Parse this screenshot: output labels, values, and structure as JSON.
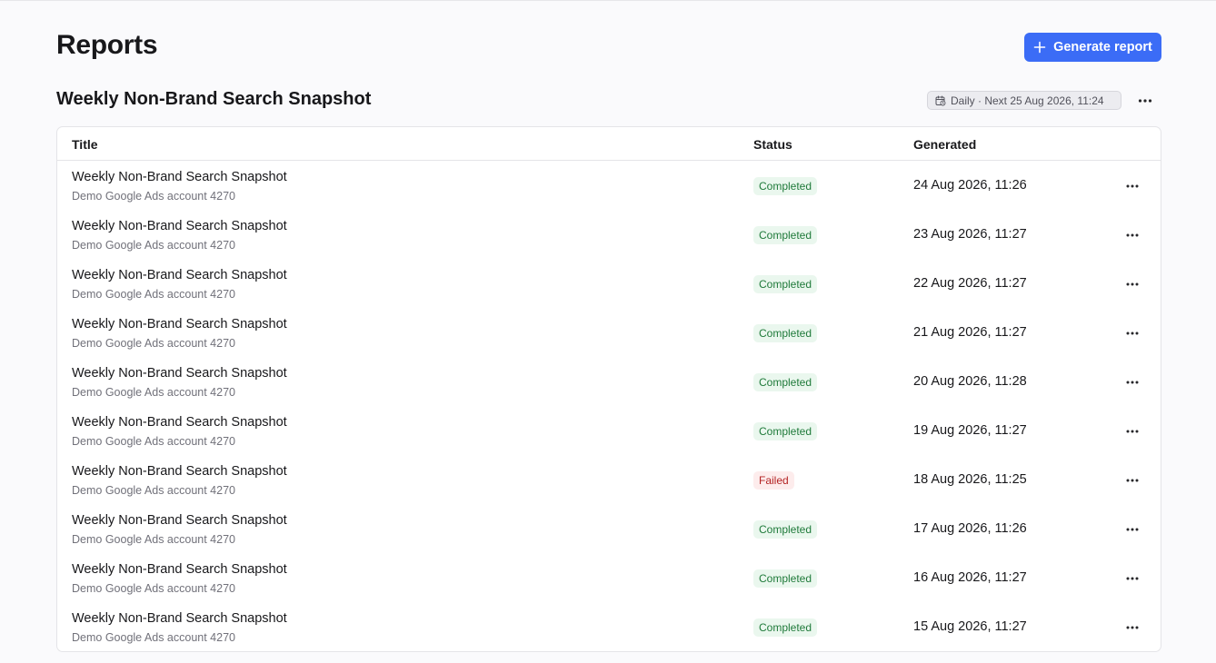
{
  "page": {
    "title": "Reports",
    "generate_button": "Generate report"
  },
  "section": {
    "title": "Weekly Non-Brand Search Snapshot",
    "schedule": "Daily · Next 25 Aug 2026, 11:24"
  },
  "table": {
    "columns": [
      "Title",
      "Status",
      "Generated"
    ],
    "rows": [
      {
        "title": "Weekly Non-Brand Search Snapshot",
        "account": "Demo Google Ads account 4270",
        "status": "Completed",
        "generated": "24 Aug 2026, 11:26"
      },
      {
        "title": "Weekly Non-Brand Search Snapshot",
        "account": "Demo Google Ads account 4270",
        "status": "Completed",
        "generated": "23 Aug 2026, 11:27"
      },
      {
        "title": "Weekly Non-Brand Search Snapshot",
        "account": "Demo Google Ads account 4270",
        "status": "Completed",
        "generated": "22 Aug 2026, 11:27"
      },
      {
        "title": "Weekly Non-Brand Search Snapshot",
        "account": "Demo Google Ads account 4270",
        "status": "Completed",
        "generated": "21 Aug 2026, 11:27"
      },
      {
        "title": "Weekly Non-Brand Search Snapshot",
        "account": "Demo Google Ads account 4270",
        "status": "Completed",
        "generated": "20 Aug 2026, 11:28"
      },
      {
        "title": "Weekly Non-Brand Search Snapshot",
        "account": "Demo Google Ads account 4270",
        "status": "Completed",
        "generated": "19 Aug 2026, 11:27"
      },
      {
        "title": "Weekly Non-Brand Search Snapshot",
        "account": "Demo Google Ads account 4270",
        "status": "Failed",
        "generated": "18 Aug 2026, 11:25"
      },
      {
        "title": "Weekly Non-Brand Search Snapshot",
        "account": "Demo Google Ads account 4270",
        "status": "Completed",
        "generated": "17 Aug 2026, 11:26"
      },
      {
        "title": "Weekly Non-Brand Search Snapshot",
        "account": "Demo Google Ads account 4270",
        "status": "Completed",
        "generated": "16 Aug 2026, 11:27"
      },
      {
        "title": "Weekly Non-Brand Search Snapshot",
        "account": "Demo Google Ads account 4270",
        "status": "Completed",
        "generated": "15 Aug 2026, 11:27"
      }
    ]
  },
  "colors": {
    "accent": "#3b6cf6",
    "status_completed": "#1f7a3a",
    "status_failed": "#b42323"
  },
  "icons": {
    "generate": "plus-icon",
    "schedule": "calendar-clock-icon",
    "row_menu": "more-horizontal-icon"
  }
}
